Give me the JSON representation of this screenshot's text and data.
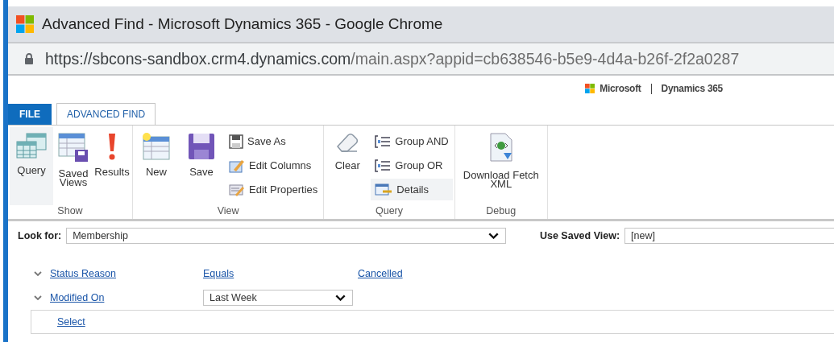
{
  "window": {
    "title": "Advanced Find - Microsoft Dynamics 365 - Google Chrome"
  },
  "address_bar": {
    "host": "https://sbcons-sandbox.crm4.dynamics.com",
    "path": "/main.aspx?appid=cb638546-b5e9-4d4a-b26f-2f2a0287"
  },
  "brand": {
    "company": "Microsoft",
    "product": "Dynamics 365"
  },
  "tabs": [
    {
      "label": "FILE",
      "kind": "file",
      "selected": false
    },
    {
      "label": "ADVANCED FIND",
      "kind": "tab",
      "selected": true
    }
  ],
  "ribbon": [
    {
      "label": "Show",
      "items": [
        {
          "label": "Query",
          "kind": "large",
          "selected": true
        },
        {
          "label": "Saved Views",
          "kind": "large",
          "selected": false
        },
        {
          "label": "Results",
          "kind": "large",
          "selected": false
        }
      ]
    },
    {
      "label": "View",
      "items": [
        {
          "label": "New",
          "kind": "large",
          "selected": false
        },
        {
          "label": "Save",
          "kind": "large",
          "selected": false
        },
        {
          "kind": "stack",
          "items": [
            {
              "label": "Save As",
              "selected": false
            },
            {
              "label": "Edit Columns",
              "selected": false
            },
            {
              "label": "Edit Properties",
              "selected": false
            }
          ]
        }
      ]
    },
    {
      "label": "Query",
      "items": [
        {
          "label": "Clear",
          "kind": "large",
          "selected": false
        },
        {
          "kind": "stack",
          "items": [
            {
              "label": "Group AND",
              "selected": false
            },
            {
              "label": "Group OR",
              "selected": false
            },
            {
              "label": "Details",
              "selected": true
            }
          ]
        }
      ]
    },
    {
      "label": "Debug",
      "items": [
        {
          "label": "Download Fetch XML",
          "kind": "large",
          "selected": false
        }
      ]
    }
  ],
  "look_for": {
    "label": "Look for:",
    "value": "Membership"
  },
  "saved_view": {
    "label": "Use Saved View:",
    "value": "[new]"
  },
  "conditions": [
    {
      "field": "Status Reason",
      "operator": {
        "kind": "link",
        "text": "Equals"
      },
      "value": "Cancelled"
    },
    {
      "field": "Modified On",
      "operator": {
        "kind": "select",
        "text": "Last Week"
      }
    }
  ],
  "select_link": "Select"
}
